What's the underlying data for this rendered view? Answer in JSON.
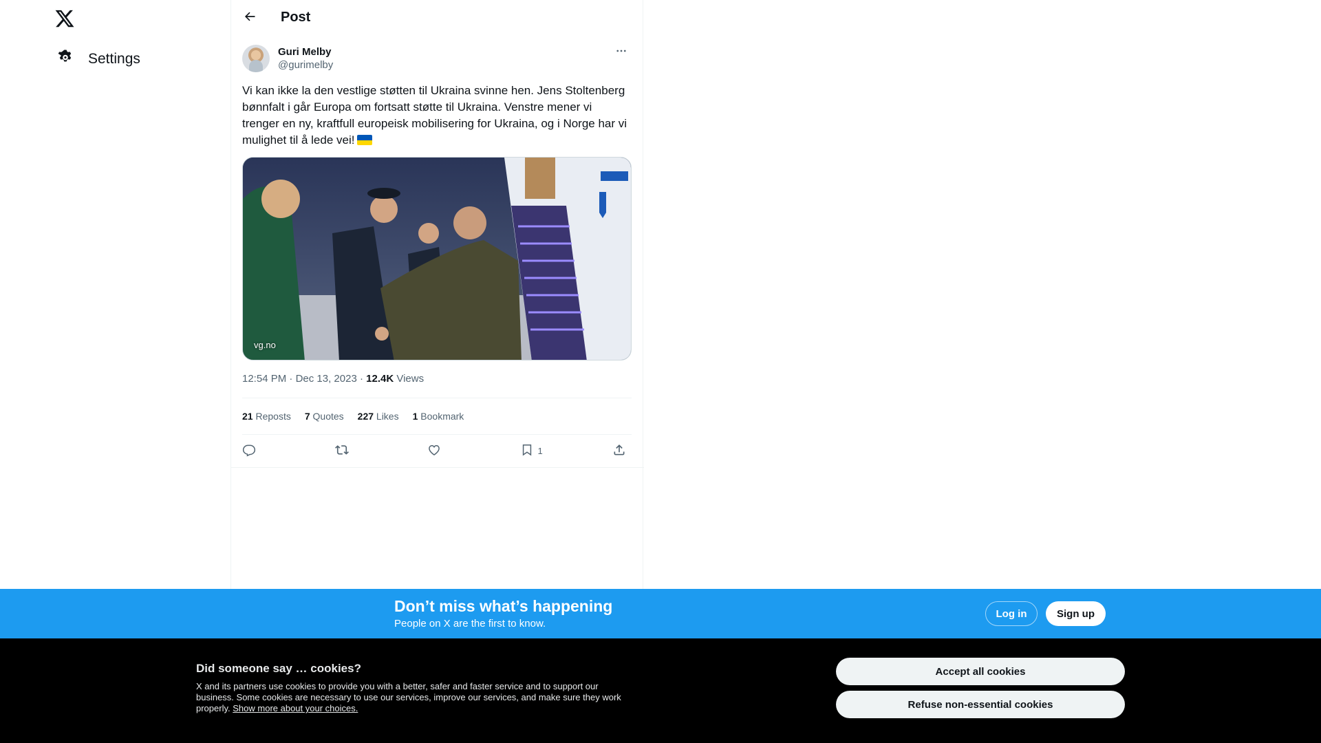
{
  "sidebar": {
    "logo_icon": "x-logo-icon",
    "settings_label": "Settings",
    "settings_icon": "gear-icon"
  },
  "header": {
    "title": "Post",
    "back_icon": "arrow-left-icon"
  },
  "post": {
    "author_name": "Guri Melby",
    "author_handle": "@gurimelby",
    "text": "Vi kan ikke la den vestlige støtten til Ukraina svinne hen. Jens Stoltenberg bønnfalt i går Europa om fortsatt støtte til Ukraina. Venstre mener vi trenger en ny, kraftfull europeisk mobilisering for Ukraina, og i Norge har vi mulighet til å lede vei!",
    "flag_icon": "ukraine-flag-icon",
    "media_source": "vg.no",
    "time": "12:54 PM",
    "date": "Dec 13, 2023",
    "views_count": "12.4K",
    "views_label": "Views",
    "separator": "·"
  },
  "stats": {
    "reposts_count": "21",
    "reposts_label": "Reposts",
    "quotes_count": "7",
    "quotes_label": "Quotes",
    "likes_count": "227",
    "likes_label": "Likes",
    "bookmarks_count": "1",
    "bookmarks_label": "Bookmark"
  },
  "actions": {
    "bookmark_count": "1"
  },
  "banner": {
    "title": "Don’t miss what’s happening",
    "subtitle": "People on X are the first to know.",
    "login_label": "Log in",
    "signup_label": "Sign up",
    "color": "#1d9bf0"
  },
  "cookies": {
    "title": "Did someone say … cookies?",
    "text": "X and its partners use cookies to provide you with a better, safer and faster service and to support our business. Some cookies are necessary to use our services, improve our services, and make sure they work properly.",
    "link_label": "Show more about your choices.",
    "accept_label": "Accept all cookies",
    "refuse_label": "Refuse non-essential cookies"
  }
}
